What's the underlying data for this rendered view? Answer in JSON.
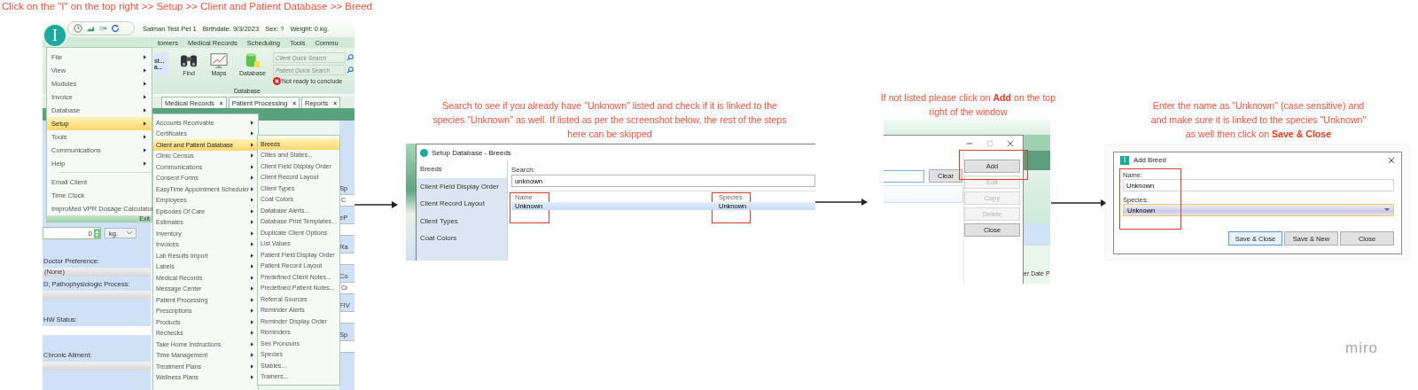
{
  "instruction": "Click on the  \"I\" on the top right >> Setup >> Client and Patient Database >> Breed",
  "step1": {
    "app_logo": "I",
    "patient_bar": {
      "name": "Salman Test Pet 1",
      "birthdate": "Birthdate:  9/3/2023",
      "sex": "Sex:  ?",
      "weight": "Weight:  0 kg."
    },
    "menu_tabs": [
      "tomers",
      "Medical Records",
      "Scheduling",
      "Tools",
      "Commu"
    ],
    "ribbon": {
      "partial_button": [
        "st...",
        "a..."
      ],
      "buttons": [
        {
          "label": "Find",
          "kind": "binoculars"
        },
        {
          "label": "Maps",
          "kind": "chart"
        },
        {
          "label": "Database",
          "kind": "database"
        }
      ],
      "group_label": "Database",
      "client_search": {
        "placeholder": "Client Quick Search"
      },
      "patient_search": {
        "placeholder": "Patient Quick Search"
      },
      "status": "Not ready to conclude"
    },
    "document_tabs": [
      {
        "label": "Medical Records",
        "close": "×"
      },
      {
        "label": "Patient Processing",
        "close": "×"
      },
      {
        "label": "Reports",
        "close": "×"
      }
    ],
    "form": {
      "weight_value": "0",
      "weight_unit": "kg.",
      "doctor_preference_label": "Doctor Preference:",
      "doctor_preference_value": "(None)",
      "process_label": "D; Pathophysiologic Process:",
      "hw_status_label": "HW Status:",
      "chronic_ailment_label": "Chronic Ailment:",
      "right_fields": [
        {
          "label": "Sp",
          "value": "C"
        },
        {
          "label": "eP"
        },
        {
          "label": "Ra"
        },
        {
          "label": "Co",
          "value": "Cr"
        },
        {
          "label": "FIV"
        },
        {
          "label": "Sp"
        }
      ]
    },
    "app_menu": {
      "items": [
        {
          "label": "File",
          "submenu": true,
          "selected": false
        },
        {
          "label": "View",
          "submenu": true,
          "selected": false
        },
        {
          "label": "Modules",
          "submenu": true,
          "selected": false
        },
        {
          "label": "Invoice",
          "submenu": true,
          "selected": false
        },
        {
          "label": "Database",
          "submenu": true,
          "selected": false
        },
        {
          "label": "Setup",
          "submenu": true,
          "selected": true
        },
        {
          "label": "Tools",
          "submenu": true,
          "selected": false
        },
        {
          "label": "Communications",
          "submenu": true,
          "selected": false
        },
        {
          "label": "Help",
          "submenu": true,
          "selected": false
        }
      ],
      "extra_items": [
        "Email Client",
        "Time Clock",
        "ImproMed VPR Dosage Calculator"
      ],
      "exit": "Exit"
    },
    "setup_menu": [
      {
        "label": "Accounts Receivable",
        "selected": false
      },
      {
        "label": "Certificates",
        "selected": false
      },
      {
        "label": "Client and Patient Database",
        "selected": true
      },
      {
        "label": "Clinic Census",
        "selected": false
      },
      {
        "label": "Communications",
        "selected": false
      },
      {
        "label": "Consent Forms",
        "selected": false
      },
      {
        "label": "EasyTime Appointment Scheduler",
        "selected": false
      },
      {
        "label": "Employees",
        "selected": false
      },
      {
        "label": "Episodes Of Care",
        "selected": false
      },
      {
        "label": "Estimates",
        "selected": false
      },
      {
        "label": "Inventory",
        "selected": false
      },
      {
        "label": "Invoices",
        "selected": false
      },
      {
        "label": "Lab Results Import",
        "selected": false
      },
      {
        "label": "Labels",
        "selected": false
      },
      {
        "label": "Medical Records",
        "selected": false
      },
      {
        "label": "Message Center",
        "selected": false
      },
      {
        "label": "Patient Processing",
        "selected": false
      },
      {
        "label": "Prescriptions",
        "selected": false
      },
      {
        "label": "Products",
        "selected": false
      },
      {
        "label": "Rechecks",
        "selected": false
      },
      {
        "label": "Take Home Instructions",
        "selected": false
      },
      {
        "label": "Time Management",
        "selected": false
      },
      {
        "label": "Treatment Plans",
        "selected": false
      },
      {
        "label": "Wellness Plans",
        "selected": false
      }
    ],
    "database_menu": [
      {
        "label": "Breeds",
        "selected": true
      },
      {
        "label": "Cities and States...",
        "selected": false
      },
      {
        "label": "Client Field Display Order",
        "selected": false
      },
      {
        "label": "Client Record Layout",
        "selected": false
      },
      {
        "label": "Client Types",
        "selected": false
      },
      {
        "label": "Coat Colors",
        "selected": false
      },
      {
        "label": "Database Alerts...",
        "selected": false
      },
      {
        "label": "Database Print Templates...",
        "selected": false
      },
      {
        "label": "Duplicate Client Options",
        "selected": false
      },
      {
        "label": "List Values",
        "selected": false
      },
      {
        "label": "Patient Field Display Order",
        "selected": false
      },
      {
        "label": "Patient Record Layout",
        "selected": false
      },
      {
        "label": "Predefined Client Notes...",
        "selected": false
      },
      {
        "label": "Predefined Patient Notes...",
        "selected": false
      },
      {
        "label": "Referral Sources",
        "selected": false
      },
      {
        "label": "Reminder Alerts",
        "selected": false
      },
      {
        "label": "Reminder Display Order",
        "selected": false
      },
      {
        "label": "Reminders",
        "selected": false
      },
      {
        "label": "Sex Pronouns",
        "selected": false
      },
      {
        "label": "Species",
        "selected": false
      },
      {
        "label": "Stables...",
        "selected": false
      },
      {
        "label": "Trainers...",
        "selected": false
      }
    ]
  },
  "step2": {
    "caption": "Search to see if you already have \"Unknown\" listed and check if it is linked to the species \"Unknown\" as well. If listed as per the screenshot below, the rest of the steps here can be skipped",
    "window_title": "Setup Database - Breeds",
    "nav": [
      {
        "label": "Breeds",
        "selected": true
      },
      {
        "label": "Client Field Display Order",
        "selected": false
      },
      {
        "label": "Client Record Layout",
        "selected": false
      },
      {
        "label": "Client Types",
        "selected": false
      },
      {
        "label": "Coat Colors",
        "selected": false
      }
    ],
    "search_label": "Search:",
    "search_value": "unknown",
    "columns": [
      "Name",
      "Species"
    ],
    "rows": [
      {
        "cells": [
          "Unknown",
          "Unknown"
        ],
        "selected": true
      }
    ]
  },
  "step3": {
    "caption": "If not listed please click on **Add** on the top right of the window",
    "clear_button": "Clear",
    "buttons": [
      {
        "label": "Add",
        "disabled": false
      },
      {
        "label": "Edit",
        "disabled": true
      },
      {
        "label": "Copy",
        "disabled": true
      },
      {
        "label": "Delete",
        "disabled": true
      },
      {
        "label": "Close",
        "disabled": false
      }
    ],
    "background_text": "er Date P"
  },
  "step4": {
    "caption": "Enter the name as \"Unknown\" (case sensitive) and and make sure it is linked to the species \"Unknown\" as well then click on **Save & Close**",
    "logo": "I",
    "dialog_title": "Add Breed",
    "name_label": "Name:",
    "name_value": "Unknown",
    "species_label": "Species:",
    "species_value": "Unknown",
    "buttons": [
      {
        "label": "Save & Close",
        "selected": true
      },
      {
        "label": "Save & New",
        "selected": false
      },
      {
        "label": "Close",
        "selected": false
      }
    ]
  },
  "brand": "miro"
}
